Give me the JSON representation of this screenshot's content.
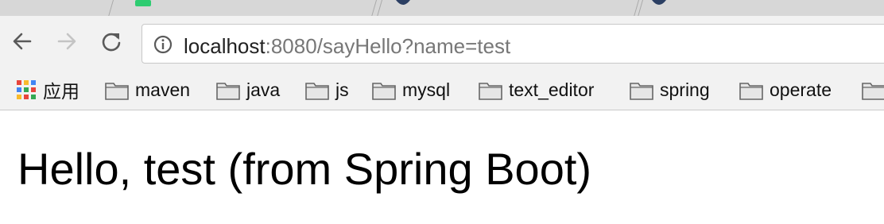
{
  "browser": {
    "tabs": [
      {
        "title": ""
      },
      {
        "title": ""
      },
      {
        "title": ""
      }
    ],
    "address_bar": {
      "host": "localhost",
      "rest": ":8080/sayHello?name=test"
    },
    "bookmarks": [
      {
        "label": "应用",
        "icon": "apps-grid-icon"
      },
      {
        "label": "maven",
        "icon": "folder-icon"
      },
      {
        "label": "java",
        "icon": "folder-icon"
      },
      {
        "label": "js",
        "icon": "folder-icon"
      },
      {
        "label": "mysql",
        "icon": "folder-icon"
      },
      {
        "label": "text_editor",
        "icon": "folder-icon"
      },
      {
        "label": "spring",
        "icon": "folder-icon"
      },
      {
        "label": "operate",
        "icon": "folder-icon"
      }
    ]
  },
  "page": {
    "heading": "Hello, test (from Spring Boot)"
  },
  "colors": {
    "chrome_bg": "#f2f2f2",
    "tabstrip_bg": "#d7d7d7",
    "url_host": "#222222",
    "url_rest": "#777777"
  }
}
